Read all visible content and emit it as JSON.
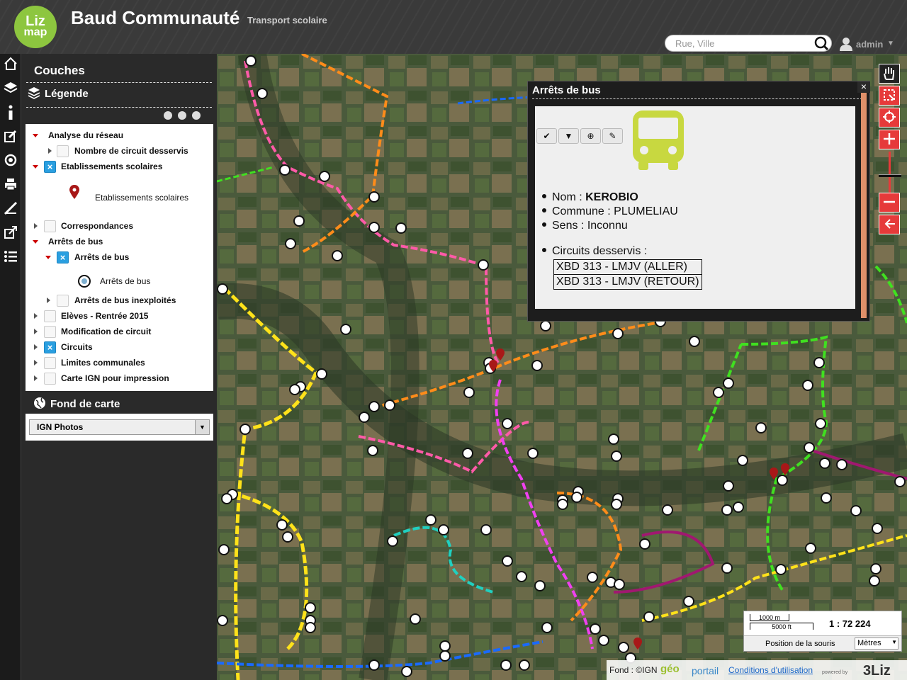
{
  "header": {
    "logo_main": "Liz",
    "logo_sub": "map",
    "title": "Baud Communauté",
    "subtitle": "Transport scolaire",
    "search_placeholder": "Rue, Ville",
    "user_name": "admin"
  },
  "left_toolbar": {
    "icons": [
      "home-icon",
      "layers-icon",
      "info-icon",
      "edit-icon",
      "locate-icon",
      "print-icon",
      "measure-icon",
      "permalink-icon",
      "list-icon"
    ]
  },
  "panel": {
    "title": "Couches",
    "legend_label": "Légende",
    "tree": [
      {
        "label": "Analyse du réseau",
        "expanded": true,
        "checkbox": false
      },
      {
        "label": "Nombre de circuit desservis",
        "expanded": false,
        "checkbox": true,
        "checked": false
      },
      {
        "label": "Etablissements scolaires",
        "expanded": true,
        "checkbox": true,
        "checked": true
      },
      {
        "label": "Etablissements scolaires",
        "legend_symbol": "marker"
      },
      {
        "label": "Correspondances",
        "expanded": false,
        "checkbox": true,
        "checked": false
      },
      {
        "label": "Arrêts de bus",
        "expanded": true,
        "checkbox": false
      },
      {
        "label": "Arrêts de bus",
        "expanded": true,
        "checkbox": true,
        "checked": true
      },
      {
        "label": "Arrêts de bus",
        "legend_symbol": "bus-stop"
      },
      {
        "label": "Arrêts de bus inexploités",
        "expanded": false,
        "checkbox": true,
        "checked": false
      },
      {
        "label": "Elèves - Rentrée 2015",
        "expanded": false,
        "checkbox": true,
        "checked": false
      },
      {
        "label": "Modification de circuit",
        "expanded": false,
        "checkbox": true,
        "checked": false
      },
      {
        "label": "Circuits",
        "expanded": false,
        "checkbox": true,
        "checked": true
      },
      {
        "label": "Limites communales",
        "expanded": false,
        "checkbox": true,
        "checked": false
      },
      {
        "label": "Carte IGN pour impression",
        "expanded": false,
        "checkbox": true,
        "checked": false
      }
    ],
    "basemap_label": "Fond de carte",
    "basemap_selected": "IGN Photos"
  },
  "popup": {
    "title": "Arrêts de bus",
    "close_label": "×",
    "tools": [
      "check-icon",
      "filter-icon",
      "zoom-icon",
      "pencil-icon"
    ],
    "fields": {
      "nom_label": "Nom : ",
      "nom_value": "KEROBIO",
      "commune_label": "Commune : ",
      "commune_value": "PLUMELIAU",
      "sens_label": "Sens : ",
      "sens_value": "Inconnu",
      "circuits_label": "Circuits desservis :"
    },
    "circuits": [
      "XBD 313 - LMJV (ALLER)",
      "XBD 313 - LMJV (RETOUR)"
    ],
    "bus_icon_color": "#c8d840"
  },
  "map_controls": {
    "scale_top": "1000 m",
    "scale_bottom": "5000 ft",
    "scale_ratio": "1 : 72 224",
    "mouse_position_label": "Position de la souris",
    "units": "Mètres"
  },
  "attribution": {
    "fond": "Fond : ©IGN",
    "geo": "géo",
    "portail": "portail",
    "cgu": "Conditions d'utilisation",
    "powered": "powered by",
    "brand": "3Liz"
  },
  "colors": {
    "accent": "#e63a3a",
    "checkbox_on": "#2a9fe0",
    "logo_green": "#8dc63f"
  }
}
